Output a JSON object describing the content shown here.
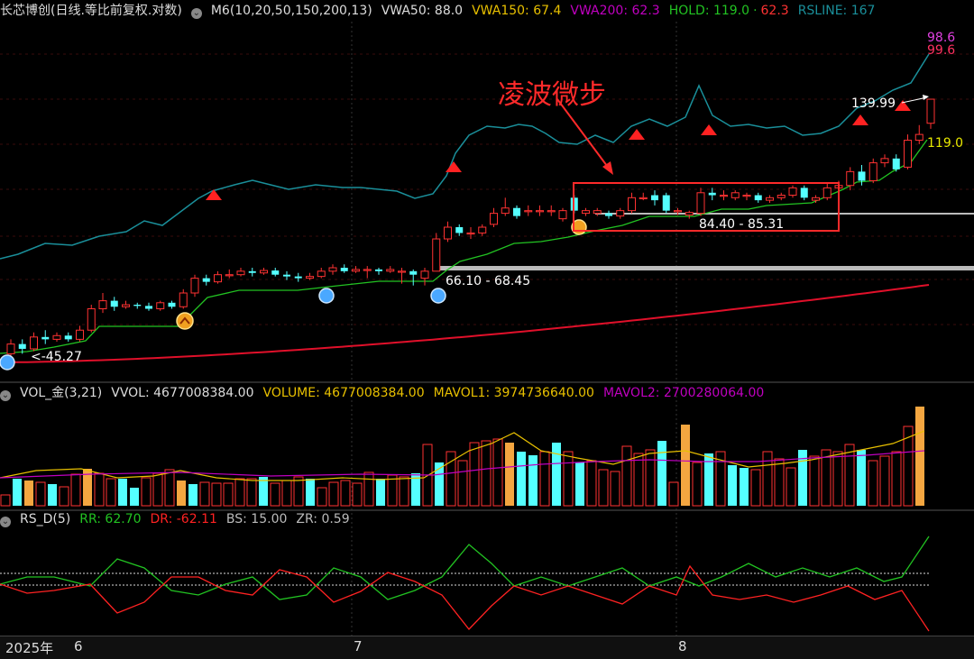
{
  "main_header": {
    "title": "长芯博创(日线.等比前复权.对数)",
    "m6": "M6(10,20,50,150,200,13)",
    "vwa50": "VWA50: 88.0",
    "vwa150": "VWA150: 67.4",
    "vwa200": "VWA200: 62.3",
    "hold": "HOLD: 119.0",
    "hold_extra": "62.3",
    "rsline": "RSLINE: 167"
  },
  "vol_header": {
    "name": "VOL_金(3,21)",
    "vvol": "VVOL: 4677008384.00",
    "volume": "VOLUME: 4677008384.00",
    "mavol1": "MAVOL1: 3974736640.00",
    "mavol2": "MAVOL2: 2700280064.00"
  },
  "rs_header": {
    "name": "RS_D(5)",
    "rr": "RR: 62.70",
    "dr": "DR: -62.11",
    "bs": "BS: 15.00",
    "zr": "ZR: 0.59"
  },
  "annotations": {
    "pattern_label": "凌波微步",
    "range_66": "66.10 - 68.45",
    "range_84": "84.40 - 85.31",
    "low_45": "45.27",
    "high_139": "139.99",
    "hold_119": "119.0",
    "rs_98": "98.6",
    "rs_99": "99.6"
  },
  "xaxis": {
    "year": "2025年",
    "m6": "6",
    "m7": "7",
    "m8": "8"
  },
  "colors": {
    "up": "#ff3232",
    "down": "#54ffff",
    "teal_line": "#1a8f9a",
    "green_line": "#22c322",
    "red_line": "#e0102a",
    "vwa150": "#e8c000",
    "vwa200": "#c000c0"
  },
  "chart_data": {
    "type": "candlestick",
    "scale": "log",
    "bars": [
      {
        "o": 46,
        "c": 48,
        "h": 49,
        "l": 45.27
      },
      {
        "o": 48,
        "c": 47,
        "h": 49,
        "l": 46
      },
      {
        "o": 47,
        "c": 49.5,
        "h": 50.5,
        "l": 46.5
      },
      {
        "o": 49.5,
        "c": 49,
        "h": 51,
        "l": 48
      },
      {
        "o": 49,
        "c": 49.8,
        "h": 50.5,
        "l": 48.5
      },
      {
        "o": 49.8,
        "c": 49,
        "h": 50.5,
        "l": 48.5
      },
      {
        "o": 49,
        "c": 51,
        "h": 52,
        "l": 48.5
      },
      {
        "o": 51,
        "c": 56,
        "h": 57,
        "l": 50.5
      },
      {
        "o": 56,
        "c": 58,
        "h": 60,
        "l": 55
      },
      {
        "o": 58,
        "c": 56.5,
        "h": 59,
        "l": 55.5
      },
      {
        "o": 56.5,
        "c": 57,
        "h": 58,
        "l": 56
      },
      {
        "o": 57,
        "c": 56.7,
        "h": 57.5,
        "l": 56
      },
      {
        "o": 56.7,
        "c": 56,
        "h": 57.5,
        "l": 55.5
      },
      {
        "o": 56,
        "c": 57.5,
        "h": 58,
        "l": 55.5
      },
      {
        "o": 57.5,
        "c": 56.5,
        "h": 58,
        "l": 56
      },
      {
        "o": 56.5,
        "c": 60,
        "h": 61,
        "l": 56
      },
      {
        "o": 60,
        "c": 64,
        "h": 65,
        "l": 59
      },
      {
        "o": 64,
        "c": 63,
        "h": 65,
        "l": 62
      },
      {
        "o": 63,
        "c": 65,
        "h": 66,
        "l": 62.5
      },
      {
        "o": 65,
        "c": 65,
        "h": 66.5,
        "l": 64
      },
      {
        "o": 65,
        "c": 66,
        "h": 67,
        "l": 64.5
      },
      {
        "o": 66,
        "c": 65.5,
        "h": 67,
        "l": 64.5
      },
      {
        "o": 65.5,
        "c": 66.2,
        "h": 67,
        "l": 65
      },
      {
        "o": 66.2,
        "c": 65,
        "h": 67,
        "l": 64.5
      },
      {
        "o": 65,
        "c": 64.5,
        "h": 66,
        "l": 63.5
      },
      {
        "o": 64.5,
        "c": 64,
        "h": 65.5,
        "l": 63
      },
      {
        "o": 64,
        "c": 64.5,
        "h": 65.5,
        "l": 63.5
      },
      {
        "o": 64.5,
        "c": 66,
        "h": 67,
        "l": 64
      },
      {
        "o": 66,
        "c": 67,
        "h": 68,
        "l": 65
      },
      {
        "o": 67,
        "c": 66,
        "h": 68,
        "l": 65.5
      },
      {
        "o": 66,
        "c": 66.5,
        "h": 67.5,
        "l": 65.5
      },
      {
        "o": 66.5,
        "c": 66.5,
        "h": 67.5,
        "l": 64
      },
      {
        "o": 66.5,
        "c": 66,
        "h": 67,
        "l": 65
      },
      {
        "o": 66,
        "c": 66.5,
        "h": 67.5,
        "l": 65.5
      },
      {
        "o": 66,
        "c": 66,
        "h": 67,
        "l": 62.5
      },
      {
        "o": 66,
        "c": 65,
        "h": 66.5,
        "l": 62
      },
      {
        "o": 64,
        "c": 66,
        "h": 67,
        "l": 62
      },
      {
        "o": 66,
        "c": 76,
        "h": 78,
        "l": 66
      },
      {
        "o": 76,
        "c": 80,
        "h": 82,
        "l": 75
      },
      {
        "o": 80,
        "c": 78,
        "h": 81,
        "l": 77
      },
      {
        "o": 78,
        "c": 78,
        "h": 80,
        "l": 76
      },
      {
        "o": 78,
        "c": 80,
        "h": 81,
        "l": 77
      },
      {
        "o": 81,
        "c": 85,
        "h": 87,
        "l": 80
      },
      {
        "o": 85,
        "c": 87,
        "h": 91,
        "l": 84
      },
      {
        "o": 87,
        "c": 84,
        "h": 88,
        "l": 83
      },
      {
        "o": 86,
        "c": 86,
        "h": 88,
        "l": 84
      },
      {
        "o": 86,
        "c": 86,
        "h": 88,
        "l": 84
      },
      {
        "o": 86,
        "c": 86,
        "h": 88,
        "l": 84
      },
      {
        "o": 83,
        "c": 86,
        "h": 87,
        "l": 82
      },
      {
        "o": 91,
        "c": 86,
        "h": 92,
        "l": 85
      },
      {
        "o": 85,
        "c": 86,
        "h": 87,
        "l": 84
      },
      {
        "o": 85,
        "c": 86,
        "h": 87,
        "l": 84
      },
      {
        "o": 85,
        "c": 84,
        "h": 86,
        "l": 83
      },
      {
        "o": 84,
        "c": 86,
        "h": 87,
        "l": 83
      },
      {
        "o": 86,
        "c": 91,
        "h": 93,
        "l": 85
      },
      {
        "o": 91,
        "c": 91,
        "h": 93,
        "l": 90
      },
      {
        "o": 92,
        "c": 90,
        "h": 94,
        "l": 88
      },
      {
        "o": 92,
        "c": 86,
        "h": 93,
        "l": 85
      },
      {
        "o": 86,
        "c": 86,
        "h": 87,
        "l": 84.4
      },
      {
        "o": 84.4,
        "c": 85.31,
        "h": 86,
        "l": 83
      },
      {
        "o": 85,
        "c": 93,
        "h": 95,
        "l": 84
      },
      {
        "o": 93,
        "c": 92,
        "h": 95,
        "l": 90
      },
      {
        "o": 92,
        "c": 92,
        "h": 94,
        "l": 90
      },
      {
        "o": 91,
        "c": 93,
        "h": 94,
        "l": 90
      },
      {
        "o": 92,
        "c": 92,
        "h": 93,
        "l": 90
      },
      {
        "o": 92,
        "c": 90,
        "h": 93,
        "l": 89
      },
      {
        "o": 90,
        "c": 91,
        "h": 92,
        "l": 89
      },
      {
        "o": 91,
        "c": 92,
        "h": 93,
        "l": 90
      },
      {
        "o": 92,
        "c": 95,
        "h": 96,
        "l": 91
      },
      {
        "o": 95,
        "c": 91,
        "h": 96,
        "l": 90
      },
      {
        "o": 90,
        "c": 91,
        "h": 92,
        "l": 89
      },
      {
        "o": 91,
        "c": 95,
        "h": 97,
        "l": 90
      },
      {
        "o": 95,
        "c": 96,
        "h": 98,
        "l": 93
      },
      {
        "o": 96,
        "c": 102,
        "h": 104,
        "l": 94
      },
      {
        "o": 102,
        "c": 98,
        "h": 105,
        "l": 96
      },
      {
        "o": 98,
        "c": 106,
        "h": 108,
        "l": 97
      },
      {
        "o": 106,
        "c": 108,
        "h": 110,
        "l": 104
      },
      {
        "o": 108,
        "c": 103,
        "h": 110,
        "l": 102
      },
      {
        "o": 104,
        "c": 117,
        "h": 120,
        "l": 103
      },
      {
        "o": 117,
        "c": 120,
        "h": 125,
        "l": 115
      },
      {
        "o": 126,
        "c": 139.99,
        "h": 140,
        "l": 123
      }
    ],
    "volume": [
      {
        "v": 12,
        "up": true
      },
      {
        "v": 30,
        "up": false
      },
      {
        "v": 28,
        "up": true
      },
      {
        "v": 26,
        "up": true
      },
      {
        "v": 24,
        "up": false
      },
      {
        "v": 21,
        "up": true
      },
      {
        "v": 35,
        "up": true
      },
      {
        "v": 41,
        "up": true
      },
      {
        "v": 36,
        "up": true
      },
      {
        "v": 30,
        "up": true
      },
      {
        "v": 30,
        "up": false
      },
      {
        "v": 20,
        "up": false
      },
      {
        "v": 31,
        "up": true
      },
      {
        "v": 36,
        "up": true
      },
      {
        "v": 40,
        "up": true
      },
      {
        "v": 28,
        "up": true
      },
      {
        "v": 24,
        "up": false
      },
      {
        "v": 26,
        "up": true
      },
      {
        "v": 25,
        "up": true
      },
      {
        "v": 25,
        "up": true
      },
      {
        "v": 30,
        "up": true
      },
      {
        "v": 30,
        "up": true
      },
      {
        "v": 32,
        "up": false
      },
      {
        "v": 25,
        "up": true
      },
      {
        "v": 28,
        "up": true
      },
      {
        "v": 32,
        "up": true
      },
      {
        "v": 30,
        "up": false
      },
      {
        "v": 20,
        "up": true
      },
      {
        "v": 26,
        "up": true
      },
      {
        "v": 28,
        "up": true
      },
      {
        "v": 25,
        "up": true
      },
      {
        "v": 37,
        "up": true
      },
      {
        "v": 30,
        "up": false
      },
      {
        "v": 34,
        "up": true
      },
      {
        "v": 32,
        "up": true
      },
      {
        "v": 36,
        "up": false
      },
      {
        "v": 68,
        "up": true
      },
      {
        "v": 48,
        "up": false
      },
      {
        "v": 60,
        "up": true
      },
      {
        "v": 50,
        "up": true
      },
      {
        "v": 70,
        "up": true
      },
      {
        "v": 72,
        "up": true
      },
      {
        "v": 74,
        "up": true
      },
      {
        "v": 70,
        "up": true
      },
      {
        "v": 60,
        "up": false
      },
      {
        "v": 56,
        "up": false
      },
      {
        "v": 60,
        "up": true
      },
      {
        "v": 70,
        "up": false
      },
      {
        "v": 60,
        "up": true
      },
      {
        "v": 48,
        "up": false
      },
      {
        "v": 50,
        "up": true
      },
      {
        "v": 40,
        "up": true
      },
      {
        "v": 38,
        "up": true
      },
      {
        "v": 66,
        "up": true
      },
      {
        "v": 58,
        "up": true
      },
      {
        "v": 62,
        "up": true
      },
      {
        "v": 72,
        "up": false
      },
      {
        "v": 26,
        "up": true
      },
      {
        "v": 90,
        "up": true
      },
      {
        "v": 48,
        "up": true
      },
      {
        "v": 58,
        "up": false
      },
      {
        "v": 60,
        "up": true
      },
      {
        "v": 45,
        "up": false
      },
      {
        "v": 42,
        "up": false
      },
      {
        "v": 40,
        "up": true
      },
      {
        "v": 60,
        "up": true
      },
      {
        "v": 52,
        "up": true
      },
      {
        "v": 42,
        "up": true
      },
      {
        "v": 62,
        "up": false
      },
      {
        "v": 55,
        "up": true
      },
      {
        "v": 62,
        "up": true
      },
      {
        "v": 60,
        "up": true
      },
      {
        "v": 68,
        "up": true
      },
      {
        "v": 62,
        "up": false
      },
      {
        "v": 50,
        "up": true
      },
      {
        "v": 55,
        "up": true
      },
      {
        "v": 60,
        "up": true
      },
      {
        "v": 88,
        "up": true
      },
      {
        "v": 110,
        "up": true
      }
    ]
  }
}
